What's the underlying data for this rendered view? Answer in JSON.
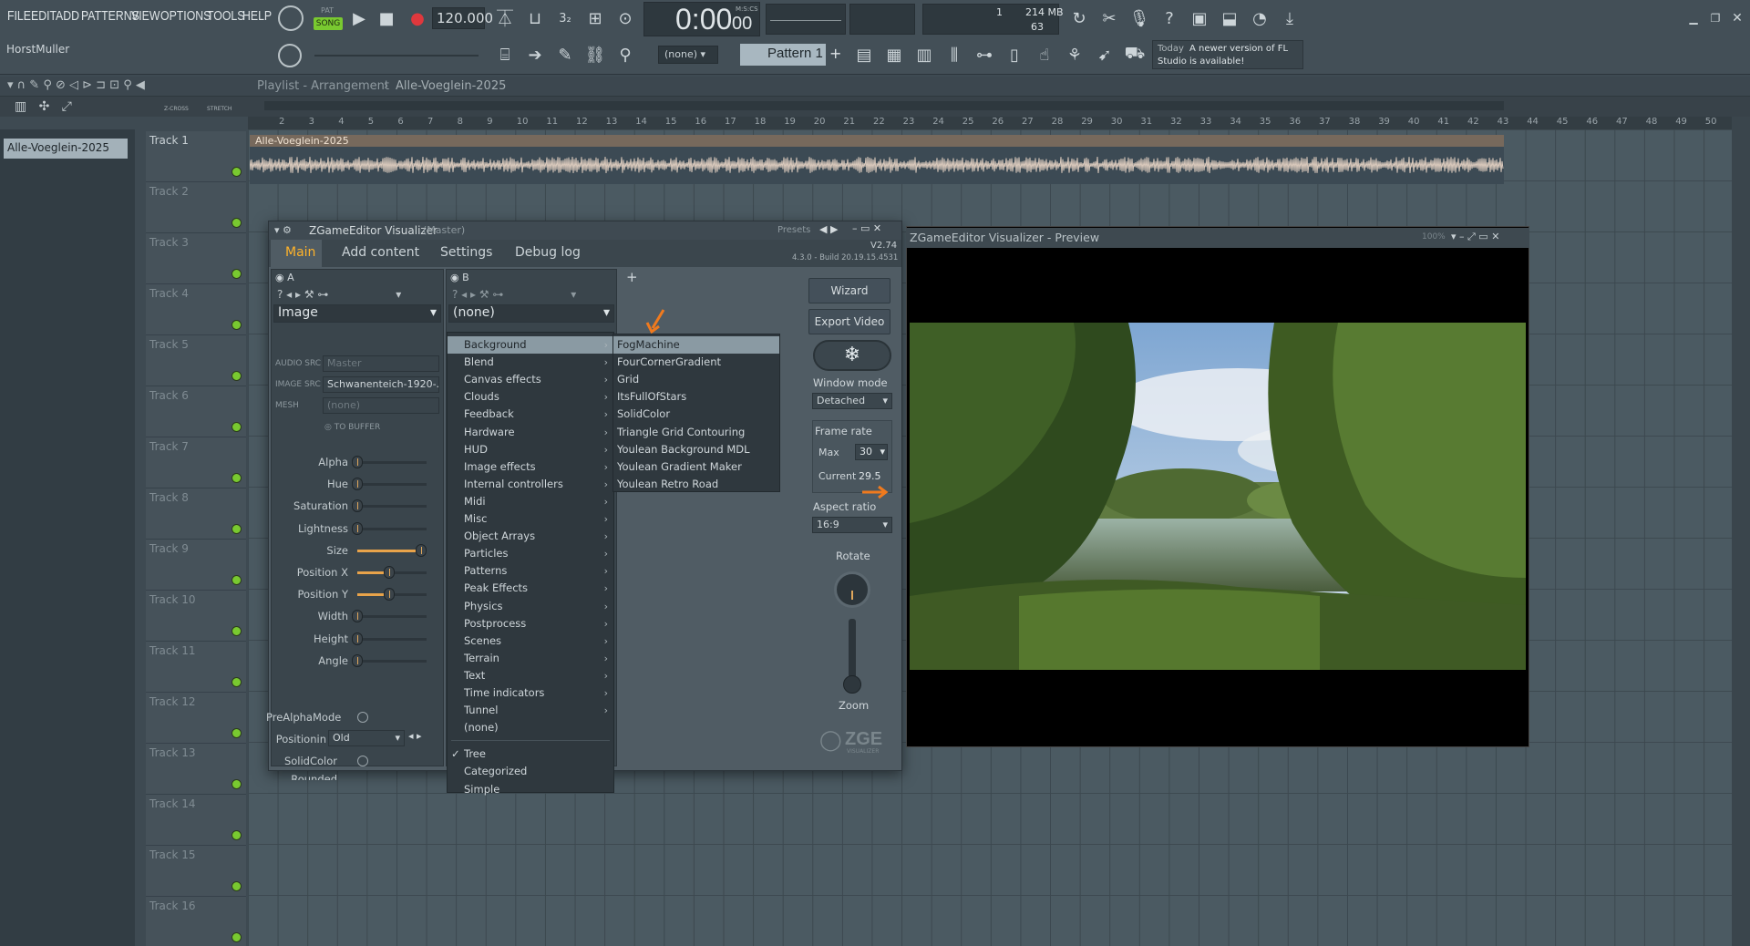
{
  "menubar": [
    "FILE",
    "EDIT",
    "ADD",
    "PATTERNS",
    "VIEW",
    "OPTIONS",
    "TOOLS",
    "HELP"
  ],
  "transport": {
    "mode_top": "PAT",
    "mode_bottom": "SONG",
    "tempo": "120.000",
    "time": "0:00",
    "time_small": "00",
    "time_unit": "M:S:CS",
    "cpu_line1": "1",
    "cpu_mem": "214 MB",
    "cpu_line2": "63"
  },
  "hint": {
    "user": "HorstMuller",
    "news_line1": "A newer version of FL",
    "news_line2": "Studio is available!",
    "news_day": "Today"
  },
  "pattern": {
    "selector": "(none)",
    "name": "Pattern 1",
    "plus": "+"
  },
  "playlist": {
    "breadcrumb": "Playlist - Arrangement",
    "separator": "›",
    "name": "Alle-Voeglein-2025",
    "clip_name": "Alle-Voeglein-2025",
    "zcross": "Z-CROSS",
    "stretch": "STRETCH",
    "left_item": "Alle-Voeglein-2025"
  },
  "ruler": [
    "2",
    "3",
    "4",
    "5",
    "6",
    "7",
    "8",
    "9",
    "10",
    "11",
    "12",
    "13",
    "14",
    "15",
    "16",
    "17",
    "18",
    "19",
    "20",
    "21",
    "22",
    "23",
    "24",
    "25",
    "26",
    "27",
    "28",
    "29",
    "30",
    "31",
    "32",
    "33",
    "34",
    "35",
    "36",
    "37",
    "38",
    "39",
    "40",
    "41",
    "42",
    "43",
    "44",
    "45",
    "46",
    "47",
    "48",
    "49",
    "50"
  ],
  "tracks": [
    "Track 1",
    "Track 2",
    "Track 3",
    "Track 4",
    "Track 5",
    "Track 6",
    "Track 7",
    "Track 8",
    "Track 9",
    "Track 10",
    "Track 11",
    "Track 12",
    "Track 13",
    "Track 14",
    "Track 15",
    "Track 16"
  ],
  "plugin": {
    "title": "ZGameEditor Visualizer",
    "title_sub": "(Master)",
    "presets": "Presets",
    "version": "V2.74",
    "build": "4.3.0 - Build 20.19.15.4531",
    "tabs": [
      "Main",
      "Add content",
      "Settings",
      "Debug log"
    ],
    "layerA": {
      "label": "A",
      "effect": "Image",
      "audio_src_label": "AUDIO SRC",
      "audio_src": "Master",
      "image_src_label": "IMAGE SRC",
      "image_src": "Schwanenteich-1920-...",
      "mesh_label": "MESH",
      "mesh": "(none)",
      "to_buffer": "TO BUFFER"
    },
    "layerB": {
      "label": "B",
      "effect": "(none)",
      "plus": "+"
    },
    "params": [
      {
        "name": "Alpha",
        "value": 0
      },
      {
        "name": "Hue",
        "value": 0
      },
      {
        "name": "Saturation",
        "value": 0
      },
      {
        "name": "Lightness",
        "value": 0
      },
      {
        "name": "Size",
        "value": 1.0
      },
      {
        "name": "Position X",
        "value": 0.5
      },
      {
        "name": "Position Y",
        "value": 0.5
      },
      {
        "name": "Width",
        "value": 0
      },
      {
        "name": "Height",
        "value": 0
      },
      {
        "name": "Angle",
        "value": 0
      }
    ],
    "prealpha": "PreAlphaMode",
    "positioning_label": "Positionin",
    "positioning": "Old",
    "solidcolor": "SolidColor",
    "rounded": "Rounded",
    "right": {
      "wizard": "Wizard",
      "export": "Export Video",
      "window_mode_label": "Window mode",
      "window_mode": "Detached",
      "frame_rate_label": "Frame rate",
      "max_label": "Max",
      "max": "30",
      "current_label": "Current",
      "current": "29.5",
      "aspect_label": "Aspect ratio",
      "aspect": "16:9",
      "rotate_label": "Rotate",
      "zoom_label": "Zoom",
      "logo": "ZGE",
      "logo_sub": "VISUALIZER"
    }
  },
  "menu_categories": [
    "Background",
    "Blend",
    "Canvas effects",
    "Clouds",
    "Feedback",
    "Hardware",
    "HUD",
    "Image effects",
    "Internal controllers",
    "Midi",
    "Misc",
    "Object Arrays",
    "Particles",
    "Patterns",
    "Peak Effects",
    "Physics",
    "Postprocess",
    "Scenes",
    "Terrain",
    "Text",
    "Time indicators",
    "Tunnel"
  ],
  "menu_none": "(none)",
  "menu_views": [
    {
      "label": "Tree",
      "checked": true
    },
    {
      "label": "Categorized",
      "checked": false
    },
    {
      "label": "Simple",
      "checked": false
    }
  ],
  "menu_background": [
    "FogMachine",
    "FourCornerGradient",
    "Grid",
    "ItsFullOfStars",
    "SolidColor",
    "Triangle Grid Contouring",
    "Youlean Background MDL",
    "Youlean Gradient Maker",
    "Youlean Retro Road"
  ],
  "preview": {
    "title": "ZGameEditor Visualizer - Preview",
    "zoom": "100%"
  },
  "colors": {
    "accent": "#ffb32a",
    "arrow": "#f07a1e",
    "led": "#79c930"
  }
}
